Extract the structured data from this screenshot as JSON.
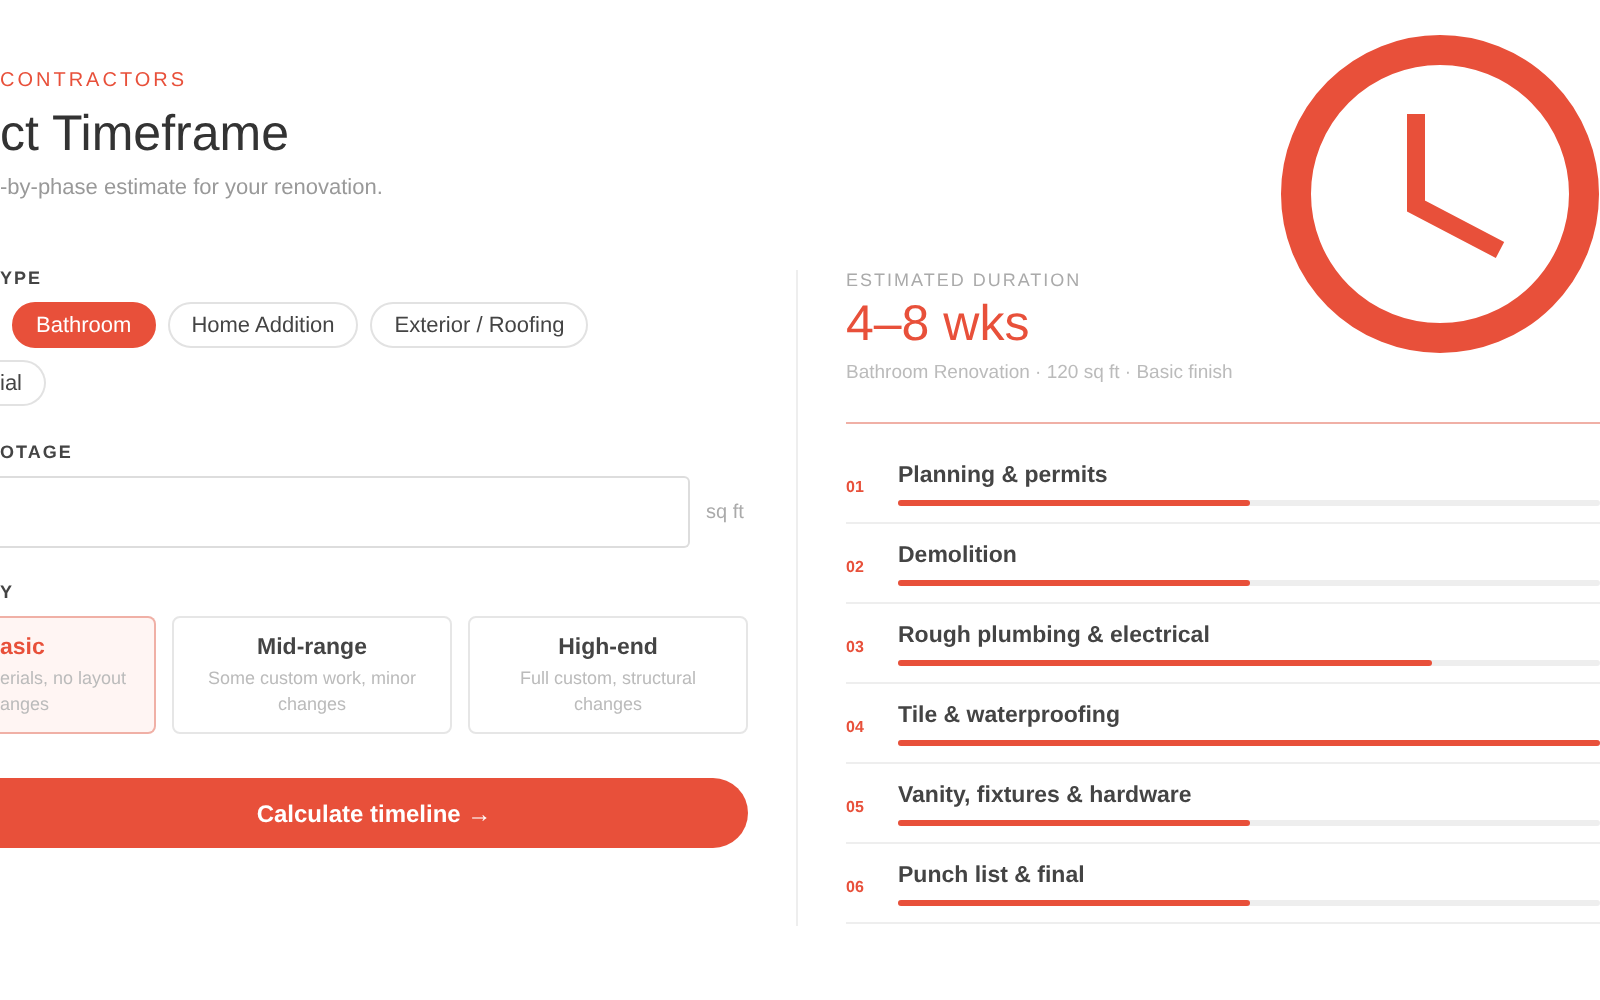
{
  "brand": "CONTRACTORS",
  "title": "ct Timeframe",
  "subtitle": "-by-phase estimate for your renovation.",
  "project_type": {
    "label": "YPE",
    "options": [
      {
        "label": "Bathroom",
        "selected": true
      },
      {
        "label": "Home Addition",
        "selected": false
      },
      {
        "label": "Exterior / Roofing",
        "selected": false
      },
      {
        "label": "ial",
        "selected": false
      }
    ]
  },
  "footage": {
    "label": "OTAGE",
    "unit": "sq ft"
  },
  "quality": {
    "label": "Y",
    "options": [
      {
        "title": "asic",
        "lines": [
          "erials, no layout",
          "anges"
        ],
        "selected": true
      },
      {
        "title": "Mid-range",
        "lines": [
          "Some custom work, minor",
          "changes"
        ],
        "selected": false
      },
      {
        "title": "High-end",
        "lines": [
          "Full custom, structural",
          "changes"
        ],
        "selected": false
      }
    ]
  },
  "calculate_button": "Calculate timeline →",
  "result": {
    "label": "ESTIMATED DURATION",
    "duration": "4–8 wks",
    "summary": "Bathroom Renovation · 120 sq ft · Basic finish"
  },
  "phases": [
    {
      "number": "01",
      "name": "Planning & permits",
      "level": 0.5
    },
    {
      "number": "02",
      "name": "Demolition",
      "level": 0.5
    },
    {
      "number": "03",
      "name": "Rough plumbing & electrical",
      "level": 0.76
    },
    {
      "number": "04",
      "name": "Tile & waterproofing",
      "level": 1
    },
    {
      "number": "05",
      "name": "Vanity, fixtures & hardware",
      "level": 0.5
    },
    {
      "number": "06",
      "name": "Punch list & final",
      "level": 0.5
    }
  ]
}
